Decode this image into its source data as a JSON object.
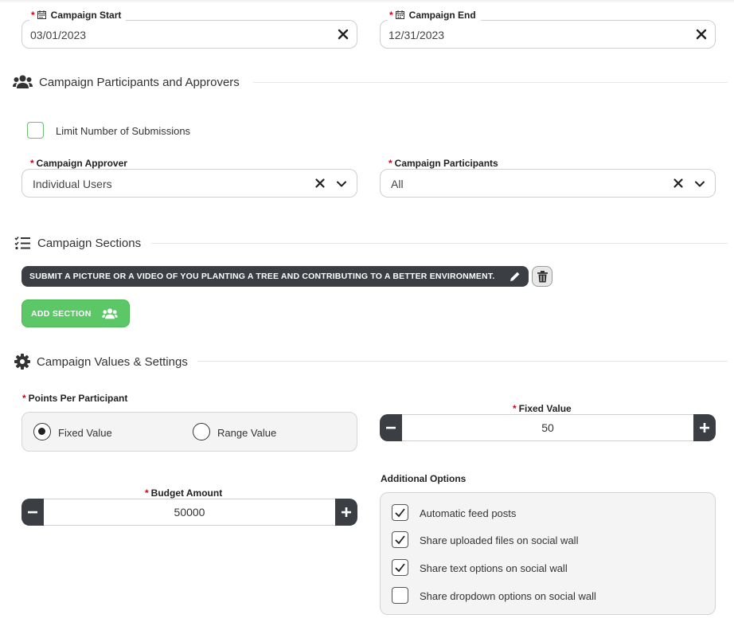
{
  "campaign_start": {
    "label": "Campaign Start",
    "value": "03/01/2023"
  },
  "campaign_end": {
    "label": "Campaign End",
    "value": "12/31/2023"
  },
  "participants_section": {
    "title": "Campaign Participants and Approvers",
    "limit_label": "Limit Number of Submissions",
    "approver_label": "Campaign Approver",
    "approver_value": "Individual Users",
    "participants_label": "Campaign Participants",
    "participants_value": "All"
  },
  "sections_section": {
    "title": "Campaign Sections",
    "chip_text": "SUBMIT A PICTURE OR A VIDEO OF YOU PLANTING A TREE AND CONTRIBUTING TO A BETTER ENVIRONMENT.",
    "add_label": "ADD SECTION"
  },
  "values_section": {
    "title": "Campaign Values & Settings",
    "points_label": "Points Per Participant",
    "radio_fixed": "Fixed Value",
    "radio_range": "Range Value",
    "selected": "Fixed Value",
    "fixed_label": "Fixed Value",
    "fixed_value": "50",
    "budget_label": "Budget Amount",
    "budget_value": "50000",
    "additional_title": "Additional Options",
    "options": [
      {
        "label": "Automatic feed posts",
        "checked": true
      },
      {
        "label": "Share uploaded files on social wall",
        "checked": true
      },
      {
        "label": "Share text options on social wall",
        "checked": true
      },
      {
        "label": "Share dropdown options on social wall",
        "checked": false
      }
    ]
  },
  "colors": {
    "accent_green": "#5cc766",
    "dark": "#3b3e42",
    "required": "#d0021b"
  }
}
